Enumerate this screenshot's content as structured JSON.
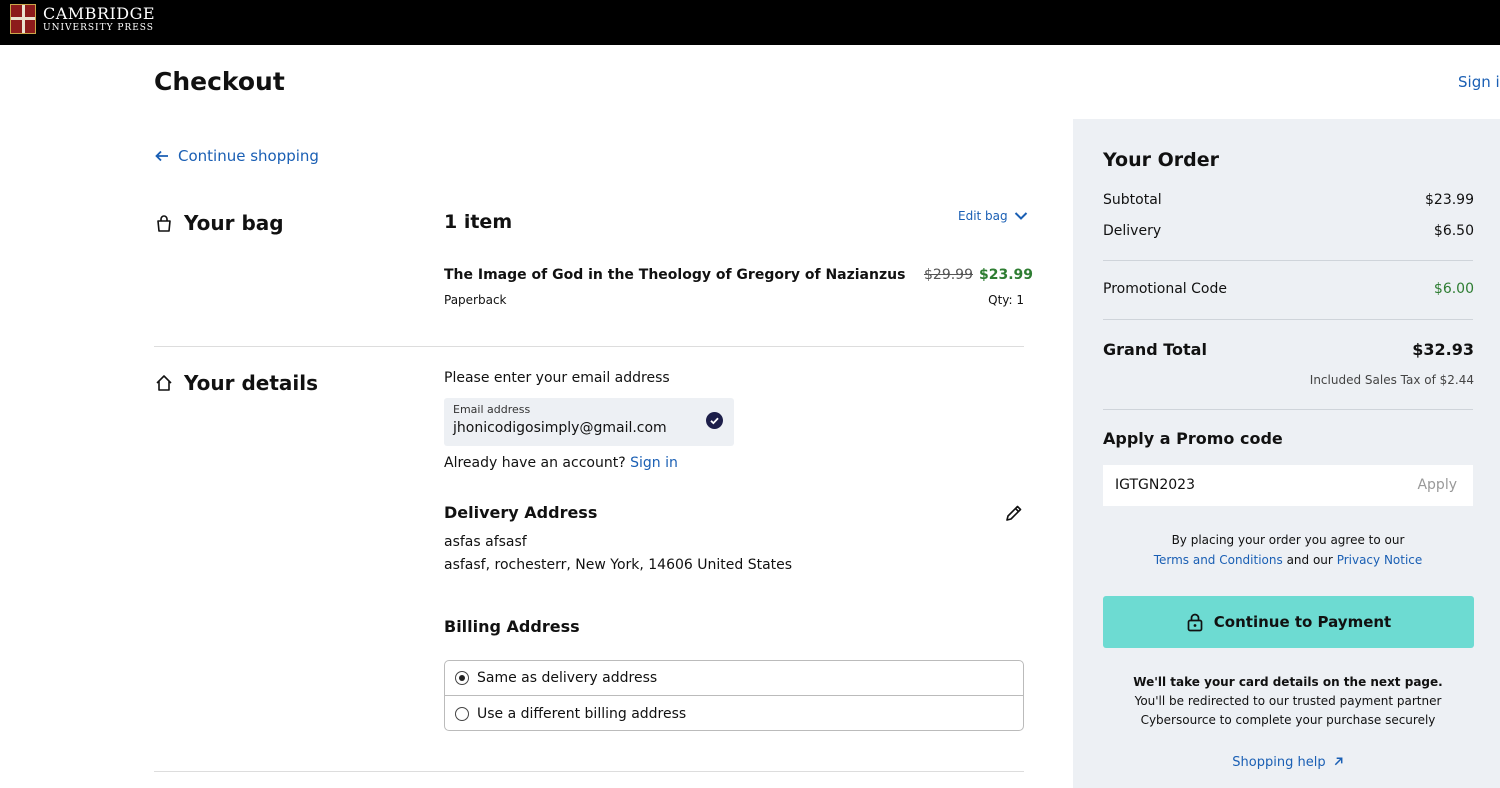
{
  "brand": {
    "line1": "CAMBRIDGE",
    "line2": "UNIVERSITY PRESS"
  },
  "header": {
    "title": "Checkout",
    "sign_in": "Sign in"
  },
  "nav": {
    "continue_shopping": "Continue shopping"
  },
  "bag": {
    "heading": "Your bag",
    "count": "1 item",
    "edit_label": "Edit bag",
    "item": {
      "title": "The Image of God in the Theology of Gregory of Nazianzus",
      "format": "Paperback",
      "old_price": "$29.99",
      "price": "$23.99",
      "qty": "Qty: 1"
    }
  },
  "details": {
    "heading": "Your details",
    "email_prompt": "Please enter your email address",
    "email_label": "Email address",
    "email_value": "jhonicodigosimply@gmail.com",
    "account_text": "Already have an account?",
    "account_link": "Sign in",
    "delivery_heading": "Delivery Address",
    "delivery_name": "asfas afsasf",
    "delivery_address": "asfasf, rochesterr, New York, 14606 United States",
    "billing_heading": "Billing Address",
    "billing_options": [
      "Same as delivery address",
      "Use a different billing address"
    ],
    "billing_selected": 0
  },
  "order": {
    "title": "Your Order",
    "subtotal_label": "Subtotal",
    "subtotal_value": "$23.99",
    "delivery_label": "Delivery",
    "delivery_value": "$6.50",
    "promo_label": "Promotional Code",
    "promo_value": "$6.00",
    "grand_label": "Grand Total",
    "grand_value": "$32.93",
    "tax_note": "Included Sales Tax of $2.44",
    "promo_heading": "Apply a Promo code",
    "promo_code": "IGTGN2023",
    "apply_label": "Apply",
    "agree_text": "By placing your order you agree to our",
    "terms_link": "Terms and Conditions",
    "agree_and": "and our",
    "privacy_link": "Privacy Notice",
    "pay_button": "Continue to Payment",
    "note_bold": "We'll take your card details on the next page.",
    "note_line1": "You'll be redirected to our trusted payment partner",
    "note_line2": "Cybersource to complete your purchase securely",
    "help_link": "Shopping help"
  },
  "colors": {
    "accent_link": "#1a5fb4",
    "pay_button": "#6ddbd2",
    "sale_price": "#2e7d32",
    "sidebar_bg": "#edf0f4"
  }
}
